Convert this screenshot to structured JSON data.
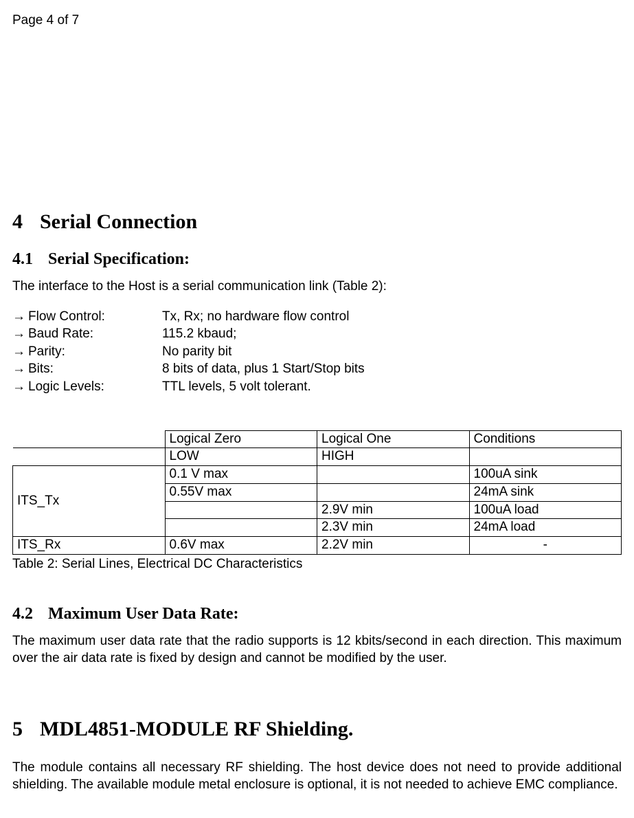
{
  "header": {
    "page_info": "Page 4 of 7"
  },
  "section4": {
    "num": "4",
    "title": "Serial Connection"
  },
  "section41": {
    "num": "4.1",
    "title": "Serial Specification:",
    "intro": "The interface to the Host is a serial communication link (Table 2):",
    "arrow": "→",
    "specs": [
      {
        "label": "Flow Control:",
        "value": "Tx, Rx; no hardware flow control"
      },
      {
        "label": "Baud Rate:",
        "value": "115.2 kbaud;"
      },
      {
        "label": "Parity:",
        "value": "No parity bit"
      },
      {
        "label": "Bits:",
        "value": "8 bits of data, plus 1 Start/Stop bits"
      },
      {
        "label": "Logic Levels:",
        "value": "TTL levels, 5 volt tolerant."
      }
    ],
    "table": {
      "header": {
        "c1": "",
        "c2": "Logical Zero",
        "c3": "Logical One",
        "c4": "Conditions"
      },
      "sub": {
        "c1": "",
        "c2": "LOW",
        "c3": "HIGH",
        "c4": ""
      },
      "tx_label": "ITS_Tx",
      "tx_rows": [
        {
          "c2": "0.1 V max",
          "c3": "",
          "c4": "100uA sink"
        },
        {
          "c2": "0.55V max",
          "c3": "",
          "c4": "24mA sink"
        },
        {
          "c2": "",
          "c3": "2.9V min",
          "c4": "100uA load"
        },
        {
          "c2": "",
          "c3": "2.3V min",
          "c4": "24mA load"
        }
      ],
      "rx_row": {
        "c1": "ITS_Rx",
        "c2": "0.6V max",
        "c3": "2.2V min",
        "c4": "-"
      },
      "caption": "Table 2: Serial Lines, Electrical DC Characteristics"
    }
  },
  "section42": {
    "num": "4.2",
    "title": "Maximum User Data Rate:",
    "body": "The maximum user data rate that the radio supports is 12 kbits/second in each direction. This maximum over the air data rate is fixed by design and cannot be modified by the user."
  },
  "section5": {
    "num": "5",
    "title": "MDL4851-MODULE RF Shielding.",
    "body": "The module contains all necessary RF shielding. The host device does not need to provide additional shielding. The available module metal enclosure is optional, it is not needed to achieve EMC compliance."
  }
}
